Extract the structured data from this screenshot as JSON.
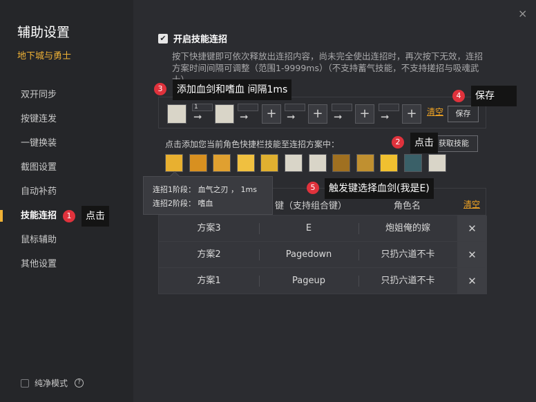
{
  "sidebar": {
    "title": "辅助设置",
    "game": "地下城与勇士",
    "items": [
      {
        "label": "双开同步"
      },
      {
        "label": "按键连发"
      },
      {
        "label": "一键换装"
      },
      {
        "label": "截图设置"
      },
      {
        "label": "自动补药"
      },
      {
        "label": "技能连招"
      },
      {
        "label": "鼠标辅助"
      },
      {
        "label": "其他设置"
      }
    ],
    "active_index": 5,
    "pure_mode_label": "纯净模式",
    "help_icon": "?"
  },
  "window": {
    "close_icon": "×"
  },
  "combo": {
    "enable_label": "开启技能连招",
    "enabled": true,
    "check_glyph": "✔",
    "description": "按下快捷键即可依次释放出连招内容，尚未完全使出连招时，再次按下无效，连招方案时间间隔可调整（范围1-9999ms）（不支持蓄气技能，不支持搓招与吸魂武士）",
    "interval_value": "1",
    "plus": "+",
    "arrow": "➞",
    "clear_label": "清空",
    "save_label": "保存",
    "skill_hint": "点击添加您当前角色快捷栏技能至连招方案中：",
    "fetch_label": "获取技能"
  },
  "skills": [
    {
      "icon": "skill-1-icon",
      "color": "#e8b030"
    },
    {
      "icon": "skill-2-icon",
      "color": "#d89020"
    },
    {
      "icon": "skill-3-icon",
      "color": "#e0a030"
    },
    {
      "icon": "skill-4-icon",
      "color": "#f0c040"
    },
    {
      "icon": "skill-5-icon",
      "color": "#e0b030"
    },
    {
      "icon": "empty-slot-icon",
      "color": "#d9d5c8"
    },
    {
      "icon": "empty-slot-icon",
      "color": "#d9d5c8"
    },
    {
      "icon": "skill-8-icon",
      "color": "#a07020"
    },
    {
      "icon": "skill-9-icon",
      "color": "#c09030"
    },
    {
      "icon": "skill-10-icon",
      "color": "#f0c030"
    },
    {
      "icon": "skill-11-icon",
      "color": "#3a6068"
    },
    {
      "icon": "empty-slot-icon",
      "color": "#d9d5c8"
    }
  ],
  "tooltip": {
    "line1": "连招1阶段：  血气之刃 ， 1ms",
    "line2": "连招2阶段：  嗜血"
  },
  "plans": {
    "headers": {
      "hotkey": "键（支持组合键）",
      "character": "角色名",
      "clear": "清空"
    },
    "rows": [
      {
        "name": "方案3",
        "key": "E",
        "character": "炮姐俺的嫁"
      },
      {
        "name": "方案2",
        "key": "Pagedown",
        "character": "只扔六道不卡"
      },
      {
        "name": "方案1",
        "key": "Pageup",
        "character": "只扔六道不卡"
      }
    ],
    "delete_glyph": "✕"
  },
  "annotations": [
    {
      "num": "1",
      "text": "点击"
    },
    {
      "num": "2",
      "text": "点击"
    },
    {
      "num": "3",
      "text": "添加血剑和嗜血 间隔1ms"
    },
    {
      "num": "4",
      "text": "保存"
    },
    {
      "num": "5",
      "text": "触发键选择血剑(我是E)"
    }
  ],
  "colors": {
    "accent": "#f0b236",
    "badge": "#e0323c",
    "link": "#f0a424"
  }
}
